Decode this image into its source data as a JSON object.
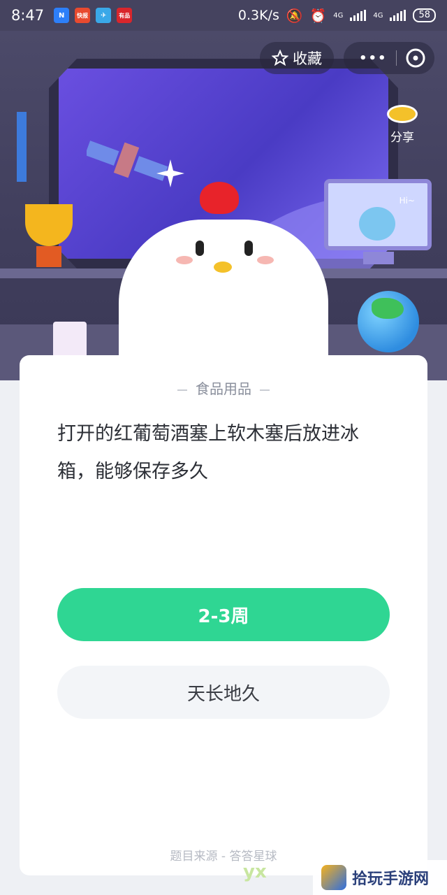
{
  "status_bar": {
    "time": "8:47",
    "app_badges": [
      {
        "label": "N",
        "color": "#2d7ff9"
      },
      {
        "label": "快报",
        "color": "#e84a2f"
      },
      {
        "label": "✈",
        "color": "#3aa8e8"
      },
      {
        "label": "有品",
        "color": "#d9262c"
      }
    ],
    "net_speed": "0.3K/s",
    "network_1": "4G",
    "network_2": "4G",
    "battery": "58"
  },
  "header": {
    "favorite_label": "收藏",
    "more_label": "•••",
    "share_label": "分享"
  },
  "scene": {
    "monitor_text": "Hi~"
  },
  "card": {
    "category": "食品用品",
    "question": "打开的红葡萄酒塞上软木塞后放进冰箱，能够保存多久",
    "answers": [
      {
        "label": "2-3周",
        "state": "selected"
      },
      {
        "label": "天长地久",
        "state": "default"
      }
    ],
    "source": "题目来源 - 答答星球"
  },
  "watermark": {
    "left_text": "yx",
    "right_text": "拾玩手游网"
  },
  "colors": {
    "accent_green": "#2fd693",
    "status_bar": "#45435f",
    "card_background": "#ffffff"
  }
}
